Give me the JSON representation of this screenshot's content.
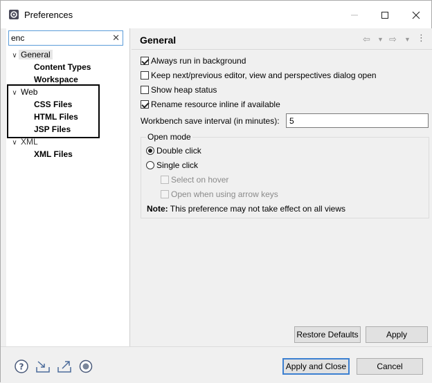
{
  "window": {
    "title": "Preferences",
    "icons": {
      "app": "gear-window-icon",
      "minimize": "minimize-icon",
      "maximize": "maximize-icon",
      "close": "close-icon"
    }
  },
  "filter": {
    "value": "enc",
    "clear_icon": "clear-icon"
  },
  "tree": {
    "general": {
      "label": "General",
      "children": [
        "Content Types",
        "Workspace"
      ]
    },
    "web": {
      "label": "Web",
      "children": [
        "CSS Files",
        "HTML Files",
        "JSP Files"
      ]
    },
    "xml": {
      "label": "XML",
      "children": [
        "XML Files"
      ]
    }
  },
  "page": {
    "title": "General",
    "options": [
      {
        "label": "Always run in background",
        "checked": true
      },
      {
        "label": "Keep next/previous editor, view and perspectives dialog open",
        "checked": false
      },
      {
        "label": "Show heap status",
        "checked": false
      },
      {
        "label": "Rename resource inline if available",
        "checked": true
      }
    ],
    "interval_label": "Workbench save interval (in minutes):",
    "interval_value": "5",
    "open_mode": {
      "legend": "Open mode",
      "double_click": "Double click",
      "single_click": "Single click",
      "select_on_hover": "Select on hover",
      "open_arrow_keys": "Open when using arrow keys",
      "selected": "double_click",
      "note_label": "Note:",
      "note_text": " This preference may not take effect on all views"
    },
    "restore_defaults": "Restore Defaults",
    "apply": "Apply"
  },
  "footer": {
    "apply_and_close": "Apply and Close",
    "cancel": "Cancel",
    "icons": [
      "help-icon",
      "import-icon",
      "export-icon",
      "record-icon"
    ]
  },
  "colors": {
    "accent": "#3b7fd1",
    "filter_border": "#5a9bd8"
  }
}
